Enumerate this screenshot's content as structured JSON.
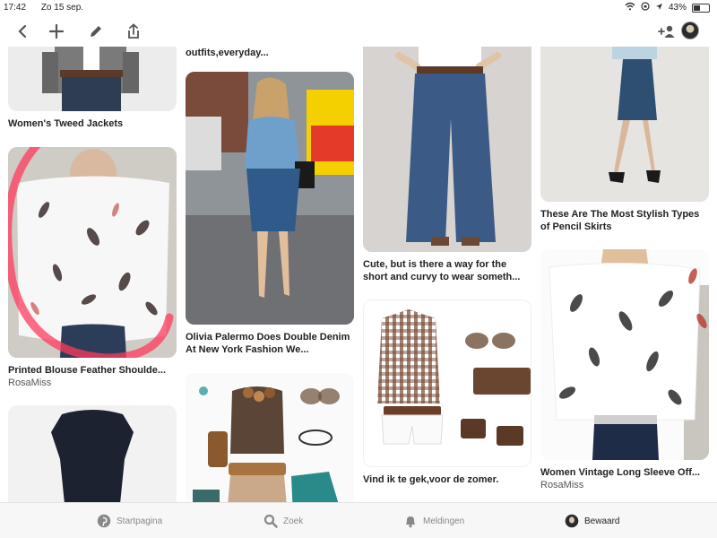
{
  "status": {
    "time": "17:42",
    "date": "Zo 15 sep.",
    "battery": "43%",
    "battery_level": 0.43
  },
  "toolbar": {
    "icons": [
      "back-icon",
      "add-icon",
      "edit-icon",
      "share-icon",
      "add-person-icon",
      "profile-avatar"
    ]
  },
  "pins": {
    "p1": {
      "title": "Women's Tweed Jackets"
    },
    "p2": {
      "title": "Printed Blouse Feather Shoulde...",
      "user": "RosaMiss"
    },
    "p3": {
      "title": "fashion,everyday outfits,everyday..."
    },
    "p4": {
      "title": "Olivia Palermo Does Double Denim At New York Fashion We..."
    },
    "p5": {
      "title": "Cute, but is there a way for the short and curvy to wear someth..."
    },
    "p6": {
      "title": "Vind ik te gek,voor de zomer."
    },
    "p7": {
      "title": "These Are The Most Stylish Types of Pencil Skirts"
    },
    "p8": {
      "title": "Women Vintage Long Sleeve Off...",
      "user": "RosaMiss"
    },
    "p9": {
      "title": ""
    },
    "p10": {
      "title": ""
    }
  },
  "tabs": {
    "home": "Startpagina",
    "search": "Zoek",
    "notifications": "Meldingen",
    "saved": "Bewaard"
  },
  "colors": {
    "accent": "#e60023",
    "highlight": "#ff3b5c"
  }
}
